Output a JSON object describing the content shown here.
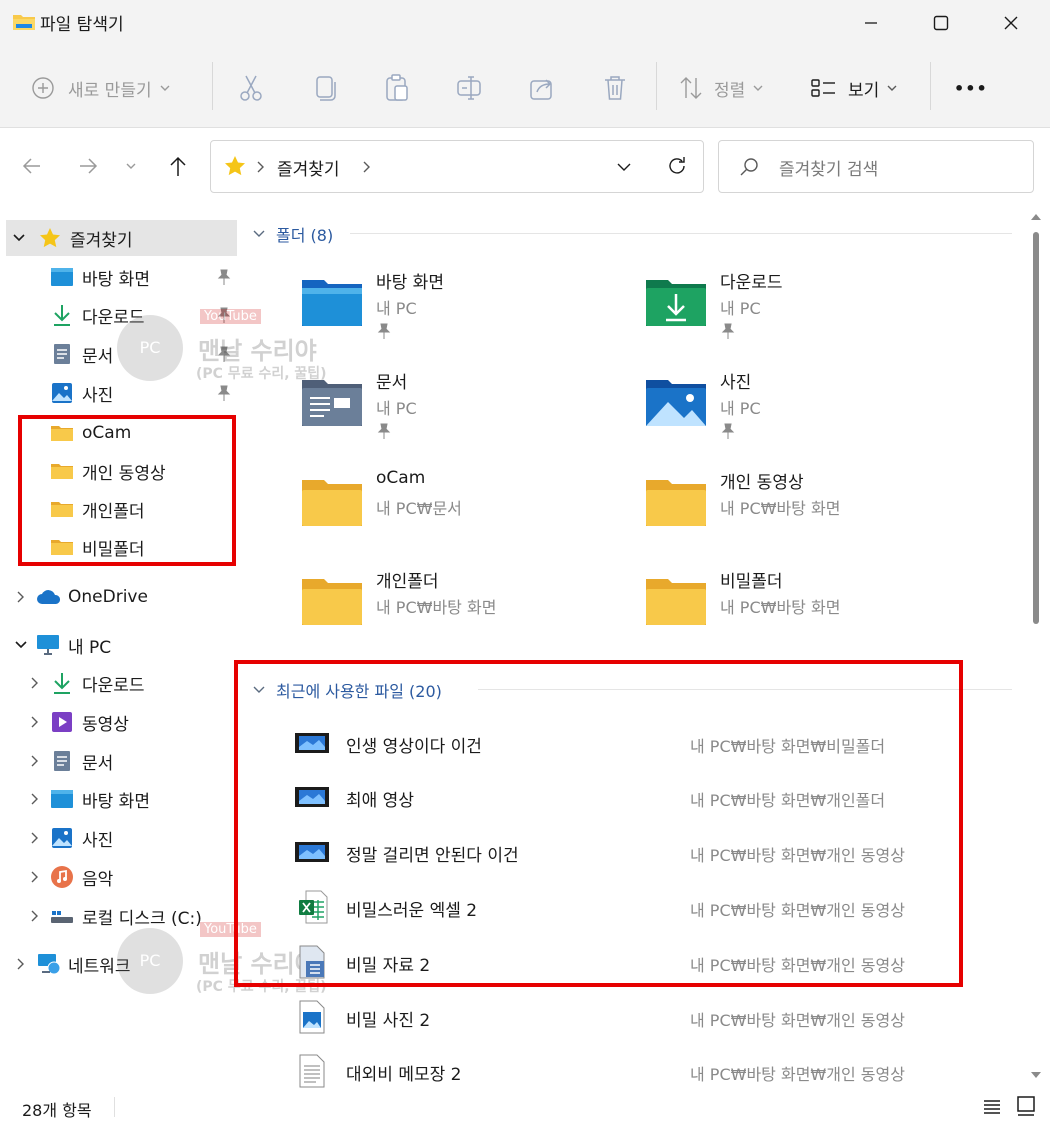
{
  "window": {
    "title": "파일 탐색기",
    "minimize_icon": "minimize-icon",
    "maximize_icon": "maximize-icon",
    "close_icon": "close-icon"
  },
  "toolbar": {
    "new_label": "새로 만들기",
    "sort_label": "정렬",
    "view_label": "보기",
    "more_label": "•••"
  },
  "address": {
    "crumb": "즐겨찾기",
    "search_placeholder": "즐겨찾기 검색"
  },
  "sidebar": {
    "favorites": "즐겨찾기",
    "pinned": [
      {
        "label": "바탕 화면",
        "icon": "desktop-icon"
      },
      {
        "label": "다운로드",
        "icon": "download-icon"
      },
      {
        "label": "문서",
        "icon": "document-icon"
      },
      {
        "label": "사진",
        "icon": "picture-icon"
      }
    ],
    "folders": [
      "oCam",
      "개인 동영상",
      "개인폴더",
      "비밀폴더"
    ],
    "onedrive": "OneDrive",
    "this_pc": "내 PC",
    "pc_items": [
      {
        "label": "다운로드",
        "icon": "download-icon"
      },
      {
        "label": "동영상",
        "icon": "video-icon"
      },
      {
        "label": "문서",
        "icon": "document-icon"
      },
      {
        "label": "바탕 화면",
        "icon": "desktop-icon"
      },
      {
        "label": "사진",
        "icon": "picture-icon"
      },
      {
        "label": "음악",
        "icon": "music-icon"
      },
      {
        "label": "로컬 디스크 (C:)",
        "icon": "drive-icon"
      }
    ],
    "network": "네트워크"
  },
  "main": {
    "folders_header": "폴더 (8)",
    "tiles": [
      {
        "name": "바탕 화면",
        "sub": "내 PC",
        "icon": "desktop-folder-icon",
        "pinned": true
      },
      {
        "name": "다운로드",
        "sub": "내 PC",
        "icon": "download-folder-icon",
        "pinned": true
      },
      {
        "name": "문서",
        "sub": "내 PC",
        "icon": "document-folder-icon",
        "pinned": true
      },
      {
        "name": "사진",
        "sub": "내 PC",
        "icon": "picture-folder-icon",
        "pinned": true
      },
      {
        "name": "oCam",
        "sub": "내 PC₩문서",
        "icon": "folder-icon",
        "pinned": false
      },
      {
        "name": "개인 동영상",
        "sub": "내 PC₩바탕 화면",
        "icon": "folder-icon",
        "pinned": false
      },
      {
        "name": "개인폴더",
        "sub": "내 PC₩바탕 화면",
        "icon": "folder-icon",
        "pinned": false
      },
      {
        "name": "비밀폴더",
        "sub": "내 PC₩바탕 화면",
        "icon": "folder-icon",
        "pinned": false
      }
    ],
    "recent_header": "최근에 사용한 파일 (20)",
    "recent": [
      {
        "name": "인생 영상이다 이건",
        "path": "내 PC₩바탕 화면₩비밀폴더",
        "icon": "video-file-icon"
      },
      {
        "name": "최애 영상",
        "path": "내 PC₩바탕 화면₩개인폴더",
        "icon": "video-file-icon"
      },
      {
        "name": "정말 걸리면 안된다 이건",
        "path": "내 PC₩바탕 화면₩개인 동영상",
        "icon": "video-file-icon"
      },
      {
        "name": "비밀스러운 엑셀 2",
        "path": "내 PC₩바탕 화면₩개인 동영상",
        "icon": "excel-file-icon"
      },
      {
        "name": "비밀 자료 2",
        "path": "내 PC₩바탕 화면₩개인 동영상",
        "icon": "data-file-icon"
      },
      {
        "name": "비밀 사진 2",
        "path": "내 PC₩바탕 화면₩개인 동영상",
        "icon": "image-file-icon"
      },
      {
        "name": "대외비 메모장 2",
        "path": "내 PC₩바탕 화면₩개인 동영상",
        "icon": "text-file-icon"
      }
    ]
  },
  "status": {
    "count": "28개 항목"
  },
  "watermark": {
    "brand": "맨날 수리야",
    "tagline": "(PC 무료 수리, 꿀팁)",
    "platform": "YouTube",
    "badge": "PC"
  },
  "colors": {
    "highlight": "#e60000",
    "accent": "#2c5aa0",
    "folder_yellow": "#f8c94a"
  }
}
